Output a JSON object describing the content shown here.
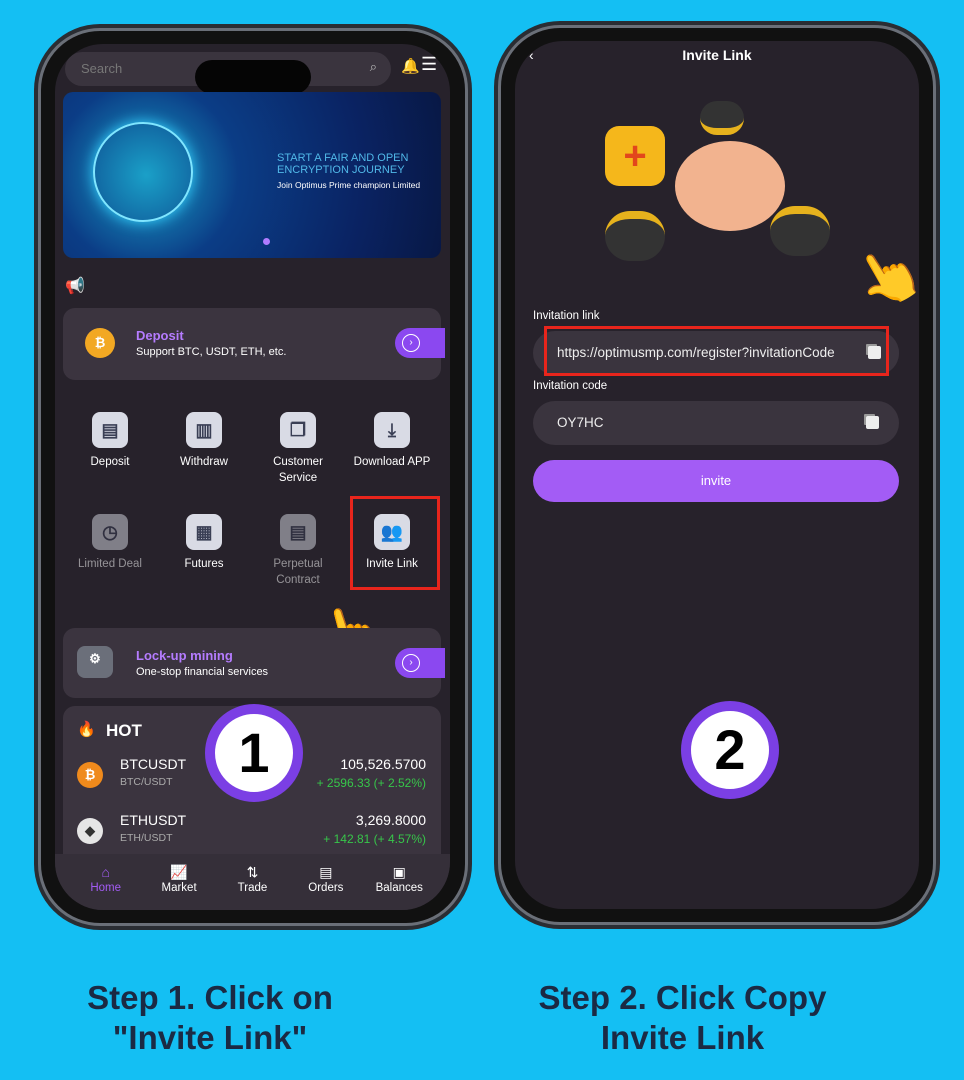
{
  "step1": {
    "search_placeholder": "Search",
    "banner": {
      "headline1": "START A FAIR AND OPEN",
      "headline2": "ENCRYPTION JOURNEY",
      "subline": "Join Optimus Prime champion Limited"
    },
    "deposit_card": {
      "title": "Deposit",
      "subtitle": "Support BTC, USDT, ETH, etc."
    },
    "grid": [
      {
        "label": "Deposit",
        "icon": "deposit-icon"
      },
      {
        "label": "Withdraw",
        "icon": "withdraw-icon"
      },
      {
        "label": "Customer Service",
        "icon": "chat-icon"
      },
      {
        "label": "Download APP",
        "icon": "download-icon"
      },
      {
        "label": "Limited Deal",
        "icon": "clock-icon"
      },
      {
        "label": "Futures",
        "icon": "futures-icon"
      },
      {
        "label": "Perpetual Contract",
        "icon": "document-icon"
      },
      {
        "label": "Invite Link",
        "icon": "users-icon"
      }
    ],
    "mining_card": {
      "title": "Lock-up mining",
      "subtitle": "One-stop financial services"
    },
    "hot": {
      "title": "HOT",
      "rows": [
        {
          "symbol": "BTCUSDT",
          "pair": "BTC/USDT",
          "price": "105,526.5700",
          "change": "+ 2596.33 (+ 2.52%)"
        },
        {
          "symbol": "ETHUSDT",
          "pair": "ETH/USDT",
          "price": "3,269.8000",
          "change": "+ 142.81 (+ 4.57%)"
        }
      ]
    },
    "nav": [
      "Home",
      "Market",
      "Trade",
      "Orders",
      "Balances"
    ],
    "badge": "1",
    "caption_line1": "Step 1. Click on",
    "caption_line2": "\"Invite Link\""
  },
  "step2": {
    "title": "Invite Link",
    "link_label": "Invitation link",
    "link_value": "https://optimusmp.com/register?invitationCode",
    "code_label": "Invitation code",
    "code_value": "OY7HC",
    "invite_button": "invite",
    "badge": "2",
    "caption_line1": "Step 2. Click Copy",
    "caption_line2": "Invite Link"
  },
  "colors": {
    "background": "#14bff3",
    "accent": "#a35cf5",
    "highlight": "#e8251c",
    "positive": "#37c64a"
  }
}
